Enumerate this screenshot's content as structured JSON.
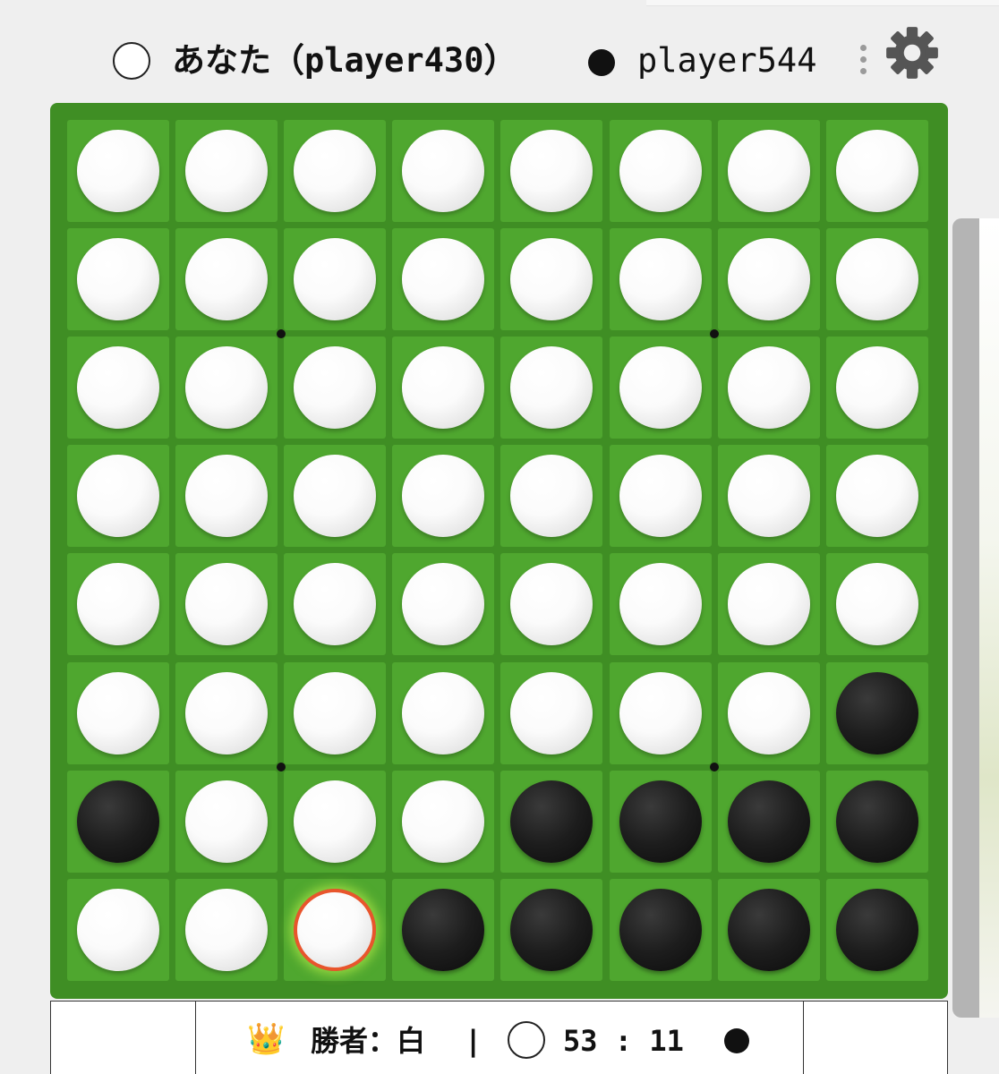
{
  "header": {
    "player1": {
      "disc_color": "white",
      "name": "あなた（player430）"
    },
    "player2": {
      "disc_color": "black",
      "name": "player544"
    },
    "menu_icon": "more-vertical-icon",
    "settings_icon": "gear-icon"
  },
  "board": {
    "size": 8,
    "rows": [
      [
        "W",
        "W",
        "W",
        "W",
        "W",
        "W",
        "W",
        "W"
      ],
      [
        "W",
        "W",
        "W",
        "W",
        "W",
        "W",
        "W",
        "W"
      ],
      [
        "W",
        "W",
        "W",
        "W",
        "W",
        "W",
        "W",
        "W"
      ],
      [
        "W",
        "W",
        "W",
        "W",
        "W",
        "W",
        "W",
        "W"
      ],
      [
        "W",
        "W",
        "W",
        "W",
        "W",
        "W",
        "W",
        "W"
      ],
      [
        "W",
        "W",
        "W",
        "W",
        "W",
        "W",
        "W",
        "B"
      ],
      [
        "B",
        "W",
        "W",
        "W",
        "B",
        "B",
        "B",
        "B"
      ],
      [
        "W",
        "W",
        "W",
        "B",
        "B",
        "B",
        "B",
        "B"
      ]
    ],
    "last_move": {
      "row": 7,
      "col": 2
    },
    "colors": {
      "board_border": "#3f8e24",
      "cell": "#4fa72f",
      "last_move_ring": "#e8552c"
    }
  },
  "status": {
    "crown_icon": "👑",
    "winner_text": "勝者：白",
    "separator": "|",
    "white_count": 53,
    "colon": ":",
    "black_count": 11,
    "score_text": "53 : 11"
  }
}
